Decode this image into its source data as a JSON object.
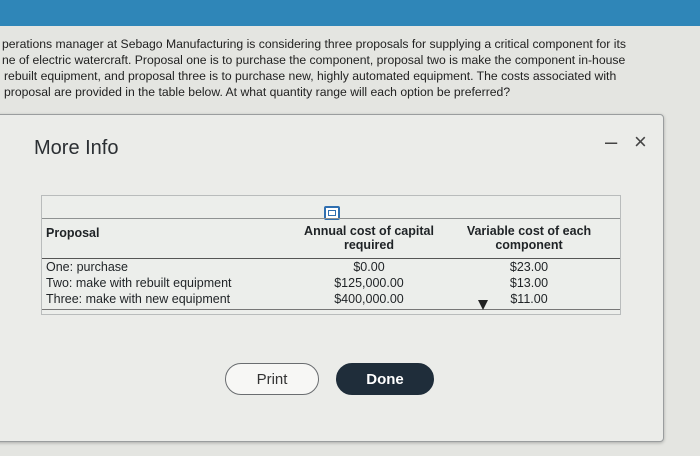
{
  "question": {
    "lines": [
      "perations manager at Sebago Manufacturing is considering three proposals for supplying a critical component for its",
      "ne of electric watercraft. Proposal one is to purchase the component, proposal two is make the component in-house",
      "rebuilt equipment, and proposal three is to purchase new, highly automated equipment. The costs associated with",
      "proposal are provided in the table below. At what quantity range will each option be preferred?"
    ]
  },
  "modal": {
    "title": "More Info",
    "minimize_glyph": "–",
    "close_glyph": "×",
    "table": {
      "headers": {
        "proposal": "Proposal",
        "capital_line1": "Annual cost of capital",
        "capital_line2": "required",
        "variable_line1": "Variable cost of each",
        "variable_line2": "component"
      },
      "rows": [
        {
          "proposal": "One: purchase",
          "capital": "$0.00",
          "variable": "$23.00"
        },
        {
          "proposal": "Two: make with rebuilt equipment",
          "capital": "$125,000.00",
          "variable": "$13.00"
        },
        {
          "proposal": "Three: make with new equipment",
          "capital": "$400,000.00",
          "variable": "$11.00"
        }
      ]
    },
    "buttons": {
      "print": "Print",
      "done": "Done"
    }
  }
}
